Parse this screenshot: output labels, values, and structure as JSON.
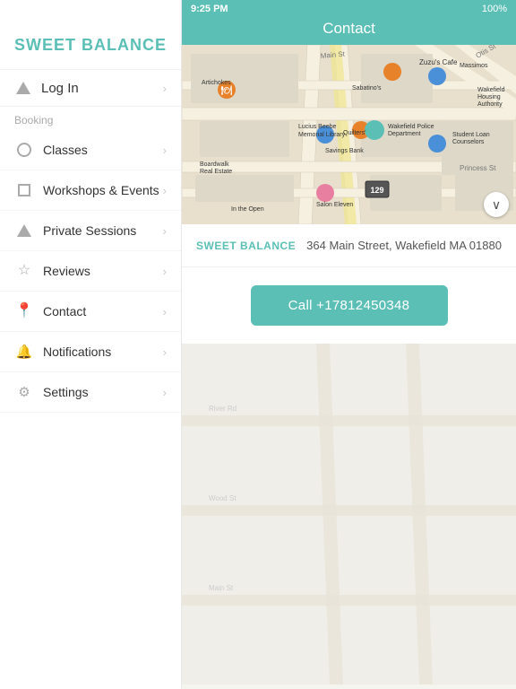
{
  "statusBar": {
    "time": "9:25 PM",
    "battery": "100%"
  },
  "header": {
    "title": "Contact"
  },
  "sidebar": {
    "brand": "SWEET BALANCE",
    "login": {
      "label": "Log In"
    },
    "sectionLabel": "Booking",
    "items": [
      {
        "id": "classes",
        "label": "Classes",
        "icon": "circle"
      },
      {
        "id": "workshops",
        "label": "Workshops & Events",
        "icon": "square"
      },
      {
        "id": "private",
        "label": "Private Sessions",
        "icon": "triangle"
      },
      {
        "id": "reviews",
        "label": "Reviews",
        "icon": "star"
      },
      {
        "id": "contact",
        "label": "Contact",
        "icon": "pin"
      },
      {
        "id": "notifications",
        "label": "Notifications",
        "icon": "bell"
      },
      {
        "id": "settings",
        "label": "Settings",
        "icon": "gear"
      }
    ]
  },
  "contact": {
    "brandLabel": "SWEET BALANCE",
    "address": "364 Main Street, Wakefield MA 01880",
    "callButton": "Call +17812450348"
  }
}
